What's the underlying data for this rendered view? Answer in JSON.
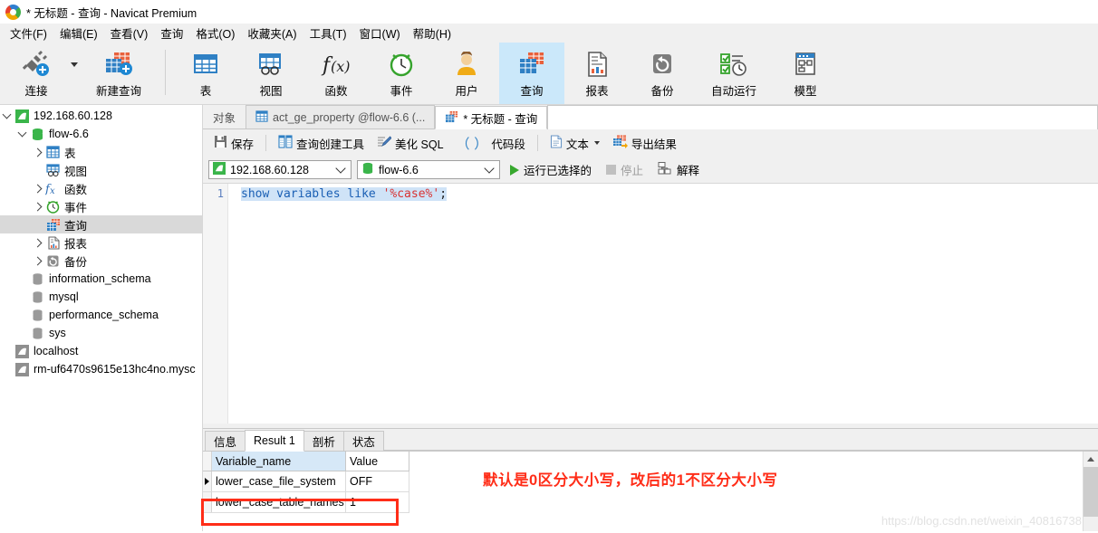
{
  "window": {
    "title": "* 无标题 - 查询 - Navicat Premium",
    "logo": "navicat-logo"
  },
  "menubar": {
    "items": [
      {
        "label": "文件(F)"
      },
      {
        "label": "编辑(E)"
      },
      {
        "label": "查看(V)"
      },
      {
        "label": "查询"
      },
      {
        "label": "格式(O)"
      },
      {
        "label": "收藏夹(A)"
      },
      {
        "label": "工具(T)"
      },
      {
        "label": "窗口(W)"
      },
      {
        "label": "帮助(H)"
      }
    ]
  },
  "toolbar": {
    "items": [
      {
        "label": "连接",
        "icon": "plug-plus-icon",
        "active": false
      },
      {
        "label": "新建查询",
        "icon": "new-query-icon",
        "active": false
      },
      {
        "label": "表",
        "icon": "table-icon",
        "active": false
      },
      {
        "label": "视图",
        "icon": "view-icon",
        "active": false
      },
      {
        "label": "函数",
        "icon": "function-fx-icon",
        "active": false
      },
      {
        "label": "事件",
        "icon": "event-clock-icon",
        "active": false
      },
      {
        "label": "用户",
        "icon": "user-icon",
        "active": false
      },
      {
        "label": "查询",
        "icon": "query-icon",
        "active": true
      },
      {
        "label": "报表",
        "icon": "report-icon",
        "active": false
      },
      {
        "label": "备份",
        "icon": "backup-icon",
        "active": false
      },
      {
        "label": "自动运行",
        "icon": "automation-icon",
        "active": false
      },
      {
        "label": "模型",
        "icon": "model-icon",
        "active": false
      }
    ]
  },
  "sidebar": {
    "items": [
      {
        "label": "192.168.60.128",
        "icon": "connection-icon",
        "indent": 0,
        "twisty": "open",
        "selected": false
      },
      {
        "label": "flow-6.6",
        "icon": "database-green-icon",
        "indent": 1,
        "twisty": "open",
        "selected": false
      },
      {
        "label": "表",
        "icon": "table-icon",
        "indent": 2,
        "twisty": "closed",
        "selected": false
      },
      {
        "label": "视图",
        "icon": "view-icon",
        "indent": 2,
        "twisty": "none",
        "selected": false
      },
      {
        "label": "函数",
        "icon": "function-fx-icon",
        "indent": 2,
        "twisty": "closed",
        "selected": false
      },
      {
        "label": "事件",
        "icon": "event-clock-icon",
        "indent": 2,
        "twisty": "closed",
        "selected": false
      },
      {
        "label": "查询",
        "icon": "query-icon",
        "indent": 2,
        "twisty": "none",
        "selected": true
      },
      {
        "label": "报表",
        "icon": "report-icon",
        "indent": 2,
        "twisty": "closed",
        "selected": false
      },
      {
        "label": "备份",
        "icon": "backup-icon",
        "indent": 2,
        "twisty": "closed",
        "selected": false
      },
      {
        "label": "information_schema",
        "icon": "database-gray-icon",
        "indent": 1,
        "twisty": "none",
        "selected": false
      },
      {
        "label": "mysql",
        "icon": "database-gray-icon",
        "indent": 1,
        "twisty": "none",
        "selected": false
      },
      {
        "label": "performance_schema",
        "icon": "database-gray-icon",
        "indent": 1,
        "twisty": "none",
        "selected": false
      },
      {
        "label": "sys",
        "icon": "database-gray-icon",
        "indent": 1,
        "twisty": "none",
        "selected": false
      },
      {
        "label": "localhost",
        "icon": "connection-gray-icon",
        "indent": 0,
        "twisty": "none",
        "selected": false
      },
      {
        "label": "rm-uf6470s9615e13hc4no.mysc",
        "icon": "connection-gray-icon",
        "indent": 0,
        "twisty": "none",
        "selected": false
      }
    ]
  },
  "tabstrip": {
    "objects_label": "对象",
    "tabs": [
      {
        "label": "act_ge_property @flow-6.6 (...",
        "icon": "table-icon",
        "active": false
      },
      {
        "label": "* 无标题 - 查询",
        "icon": "query-icon",
        "active": true
      }
    ]
  },
  "query_toolbar": {
    "save": "保存",
    "query_builder": "查询创建工具",
    "beautify_sql": "美化 SQL",
    "snippet": "代码段",
    "text": "文本",
    "export_result": "导出结果"
  },
  "connbar": {
    "connection": "192.168.60.128",
    "database": "flow-6.6",
    "run_selected": "运行已选择的",
    "stop": "停止",
    "explain": "解释"
  },
  "editor": {
    "line_number": "1",
    "sql_keyword1": "show",
    "sql_keyword2": "variables",
    "sql_keyword3": "like",
    "sql_string": "'%case%'",
    "sql_semicolon": ";",
    "full_sql": "show variables like '%case%';"
  },
  "results": {
    "tabs": [
      {
        "label": "信息",
        "active": false
      },
      {
        "label": "Result 1",
        "active": true
      },
      {
        "label": "剖析",
        "active": false
      },
      {
        "label": "状态",
        "active": false
      }
    ],
    "columns": [
      "Variable_name",
      "Value"
    ],
    "rows": [
      {
        "name": "lower_case_file_system",
        "value": "OFF",
        "marked": true
      },
      {
        "name": "lower_case_table_names",
        "value": "1",
        "marked": false
      }
    ]
  },
  "annotation": {
    "text": "默认是0区分大小写，改后的1不区分大小写",
    "color": "#ff2d18"
  },
  "watermark": {
    "text": "https://blog.csdn.net/weixin_40816738"
  }
}
